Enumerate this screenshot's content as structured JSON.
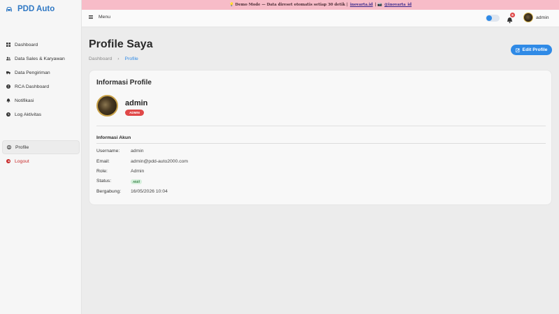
{
  "brand": {
    "name": "PDD Auto"
  },
  "banner": {
    "prefix": "💡 Demo Mode — Data direset otomatis setiap 30 detik | ",
    "link1": "inovarta.id",
    "sep": " | 📷 ",
    "link2": "@inovarta_id"
  },
  "topbar": {
    "menu_label": "Menu",
    "notif_count": "6",
    "username": "admin"
  },
  "sidebar": {
    "items": [
      {
        "label": "Dashboard",
        "icon": "grid-icon"
      },
      {
        "label": "Data Sales & Karyawan",
        "icon": "users-icon"
      },
      {
        "label": "Data Pengiriman",
        "icon": "truck-icon"
      },
      {
        "label": "RCA Dashboard",
        "icon": "alert-icon"
      },
      {
        "label": "Notifikasi",
        "icon": "bell-icon"
      },
      {
        "label": "Log Aktivitas",
        "icon": "clock-icon"
      }
    ],
    "profile_label": "Profile",
    "logout_label": "Logout"
  },
  "page": {
    "title": "Profile Saya",
    "breadcrumb": {
      "home": "Dashboard",
      "sep": "›",
      "current": "Profile"
    },
    "edit_label": "Edit Profile"
  },
  "card": {
    "title": "Informasi Profile",
    "name": "admin",
    "role_badge": "ADMIN",
    "section_title": "Informasi Akun",
    "fields": {
      "username_k": "Username:",
      "username_v": "admin",
      "email_k": "Email:",
      "email_v": "admin@pdd-auto2000.com",
      "role_k": "Role:",
      "role_v": "Admin",
      "status_k": "Status:",
      "status_v": "Aktif",
      "joined_k": "Bergabung:",
      "joined_v": "16/05/2026 10:04"
    }
  },
  "colors": {
    "accent": "#2f8ae6",
    "brand": "#2f78c4",
    "danger": "#e04848",
    "banner": "#f7bcc8"
  }
}
